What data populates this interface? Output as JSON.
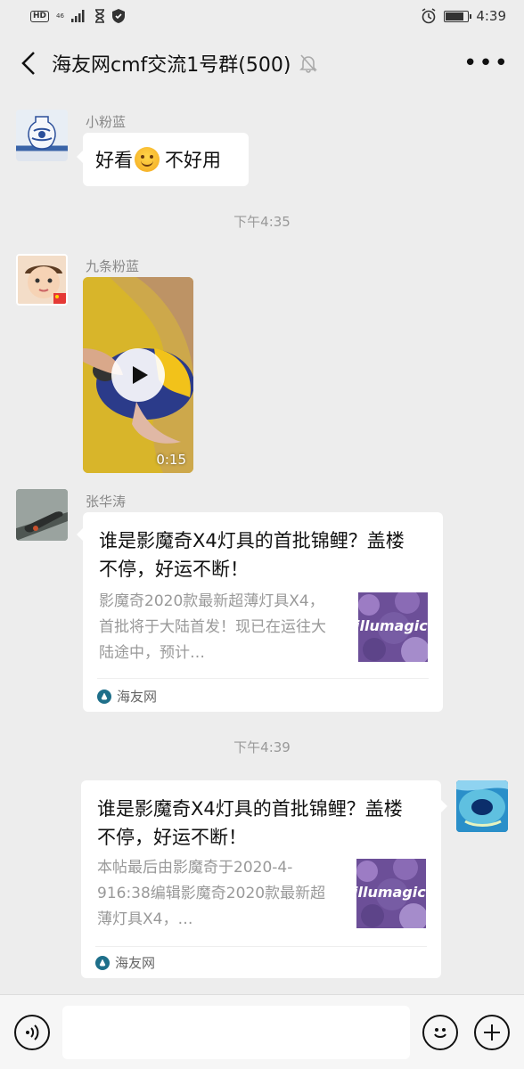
{
  "status_bar": {
    "network": "46",
    "time": "4:39"
  },
  "header": {
    "title": "海友网cmf交流1号群(500)"
  },
  "messages": [
    {
      "sender": "小粉蓝",
      "text_before": "好看",
      "text_after": " 不好用"
    },
    {
      "timestamp": "下午4:35"
    },
    {
      "sender": "九条粉蓝",
      "video_duration": "0:15"
    },
    {
      "sender": "张华涛",
      "card": {
        "title": "谁是影魔奇X4灯具的首批锦鲤？盖楼不停，好运不断！",
        "description": "影魔奇2020款最新超薄灯具X4，首批将于大陆首发！现已在运往大陆途中，预计…",
        "thumb_text": "illumagic",
        "source": "海友网"
      }
    },
    {
      "timestamp": "下午4:39"
    },
    {
      "from_self": true,
      "card": {
        "title": "谁是影魔奇X4灯具的首批锦鲤？盖楼不停，好运不断！",
        "description": "本帖最后由影魔奇于2020-4-916:38编辑影魔奇2020款最新超薄灯具X4，…",
        "thumb_text": "illumagic",
        "source": "海友网"
      }
    }
  ],
  "input": {
    "placeholder": ""
  },
  "colors": {
    "background": "#ededed",
    "bubble": "#ffffff",
    "timestamp": "#999999"
  }
}
